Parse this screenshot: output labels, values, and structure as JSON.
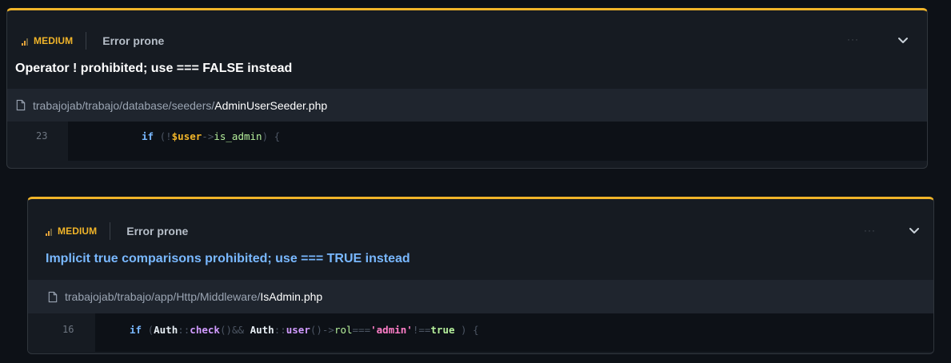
{
  "colors": {
    "accent_border": "#f0b429",
    "severity_medium": "#f0b429",
    "title_link": "#79b8ff",
    "background": "#0d1117"
  },
  "issues": [
    {
      "severity": "MEDIUM",
      "category": "Error prone",
      "title": "Operator ! prohibited; use === FALSE instead",
      "more_label": "···",
      "file": {
        "path": "trabajojab/trabajo/database/seeders/",
        "name": "AdminUserSeeder.php"
      },
      "line_number": "23",
      "code": {
        "t1": "if",
        "t2": " (",
        "t3": "!",
        "t4": "$user",
        "t5": "->",
        "t6": "is_admin",
        "t7": ") {"
      }
    },
    {
      "severity": "MEDIUM",
      "category": "Error prone",
      "title": "Implicit true comparisons prohibited; use === TRUE instead",
      "more_label": "···",
      "file": {
        "path": "trabajojab/trabajo/app/Http/Middleware/",
        "name": "IsAdmin.php"
      },
      "line_number": "16",
      "code": {
        "t1": "if",
        "t2": " (",
        "t3": "Auth",
        "t4": "::",
        "t5": "check",
        "t6": "()&& ",
        "t7": "Auth",
        "t8": "::",
        "t9": "user",
        "t10": "()->",
        "t11": "rol",
        "t12": "===",
        "t13": "'admin'",
        "t14": "!==",
        "t15": "true",
        "t16": " ) {"
      }
    }
  ]
}
